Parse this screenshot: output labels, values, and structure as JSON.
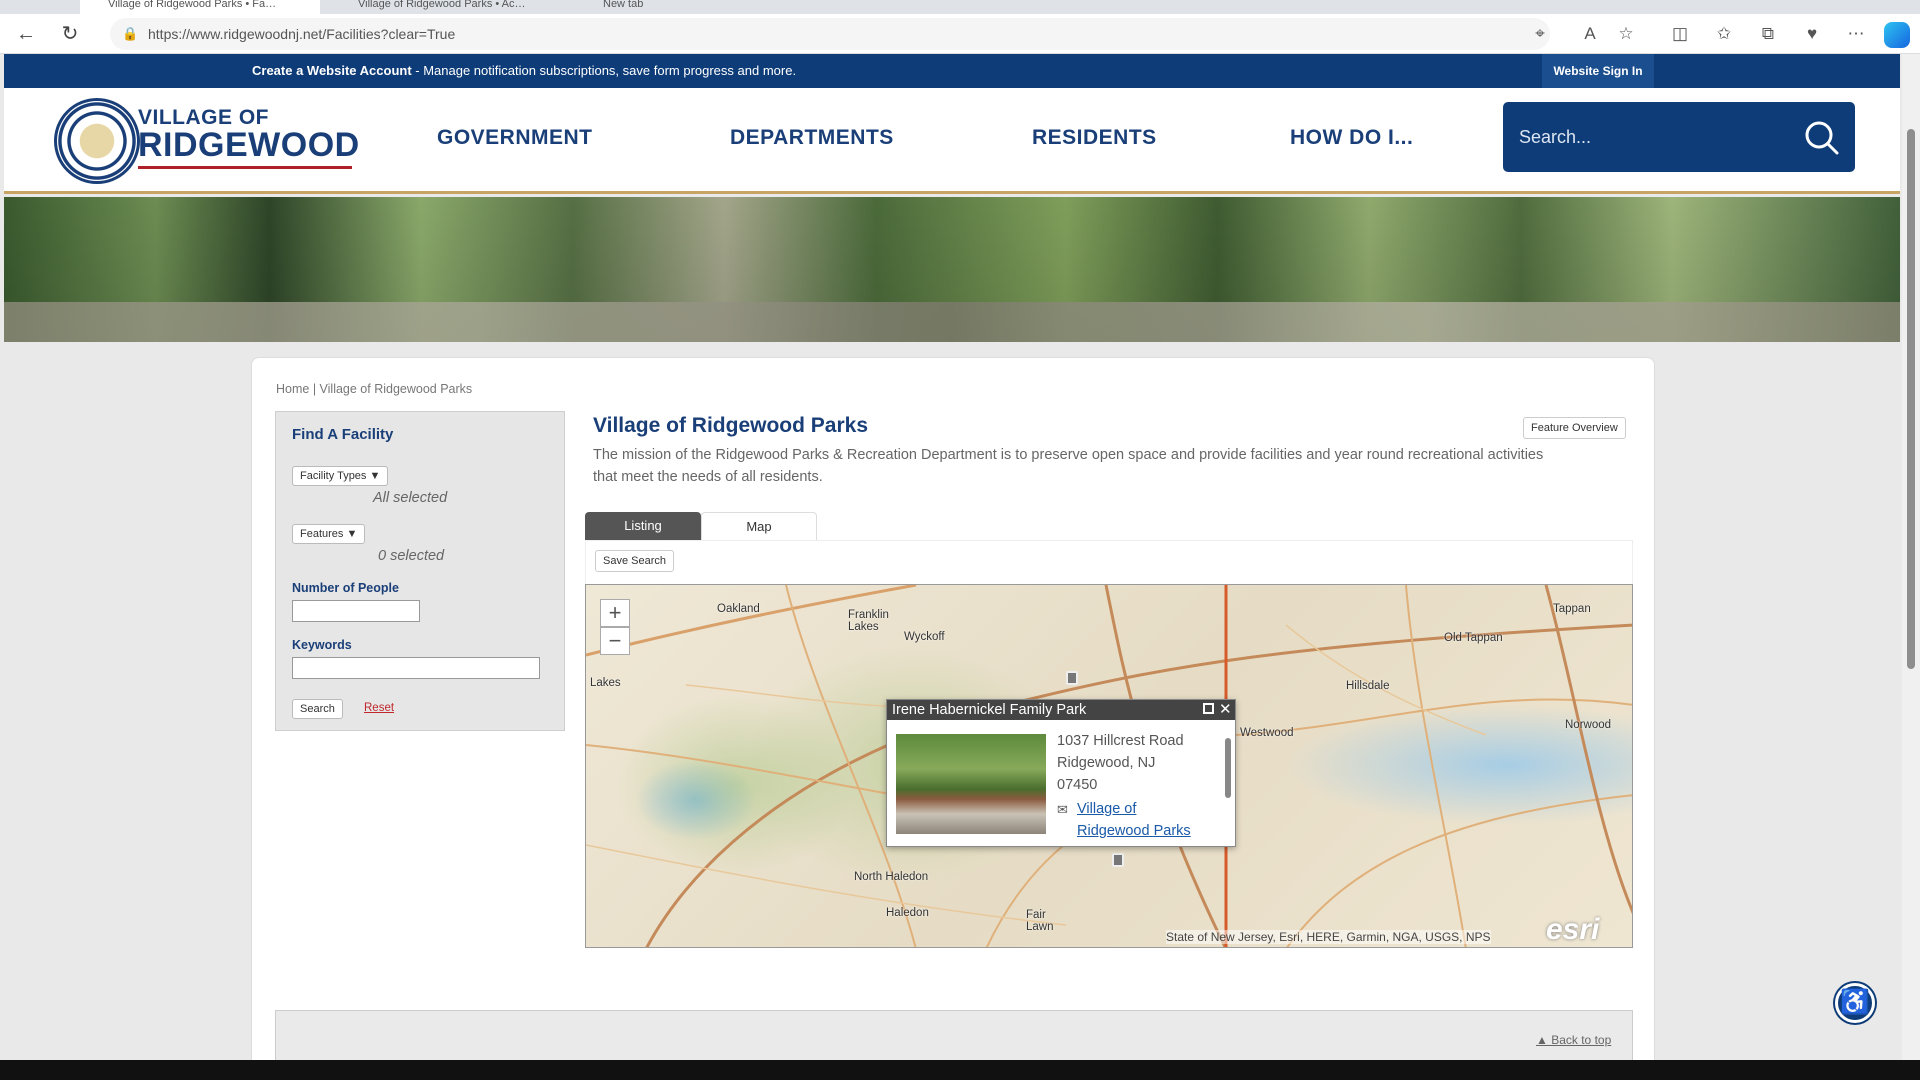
{
  "browser": {
    "tabs": [
      "Village of Ridgewood Parks • Fa…",
      "Village of Ridgewood Parks • Ac…",
      "New tab"
    ],
    "url": "https://www.ridgewoodnj.net/Facilities?clear=True"
  },
  "site": {
    "notice_bold": "Create a Website Account",
    "notice_text": " - Manage notification subscriptions, save form progress and more.",
    "signin_label": "Website Sign In",
    "logo_top": "VILLAGE OF",
    "logo_main": "RIDGEWOOD",
    "nav": [
      "GOVERNMENT",
      "DEPARTMENTS",
      "RESIDENTS",
      "HOW DO I..."
    ],
    "search_placeholder": "Search...",
    "brand_color": "#0d3c78",
    "accent_color": "#c0282d"
  },
  "breadcrumb": "Home | Village of Ridgewood Parks",
  "sidebar": {
    "title": "Find A Facility",
    "facility_types_label": "Facility Types ▼",
    "facility_types_note": "All selected",
    "features_label": "Features ▼",
    "features_note": "0 selected",
    "people_label": "Number of People",
    "keywords_label": "Keywords",
    "search_label": "Search",
    "reset_label": "Reset"
  },
  "main": {
    "title": "Village of Ridgewood Parks",
    "feature_overview_label": "Feature Overview",
    "mission": "The mission of the Ridgewood Parks & Recreation Department is to preserve open space and provide facilities and year round recreational activities that meet the needs of all residents.",
    "tabs": [
      {
        "label": "Listing"
      },
      {
        "label": "Map"
      }
    ],
    "save_search_label": "Save Search"
  },
  "map": {
    "zoom_in": "+",
    "zoom_out": "−",
    "places": [
      "Oakland",
      "Franklin Lakes",
      "Wyckoff",
      "Lakes",
      "Tappan",
      "Old Tappan",
      "Hillsdale",
      "Westwood",
      "Norwood",
      "North Haledon",
      "Haledon",
      "Fair Lawn"
    ],
    "attribution": "State of New Jersey, Esri, HERE, Garmin, NGA, USGS, NPS",
    "esri_logo": "esri",
    "popup": {
      "title": "Irene Habernickel Family Park",
      "address_line1": "1037 Hillcrest Road",
      "address_line2": "Ridgewood, NJ",
      "address_line3": "07450",
      "link": "Village of Ridgewood Parks"
    }
  },
  "footer": {
    "back_to_top": "▲ Back to top"
  }
}
